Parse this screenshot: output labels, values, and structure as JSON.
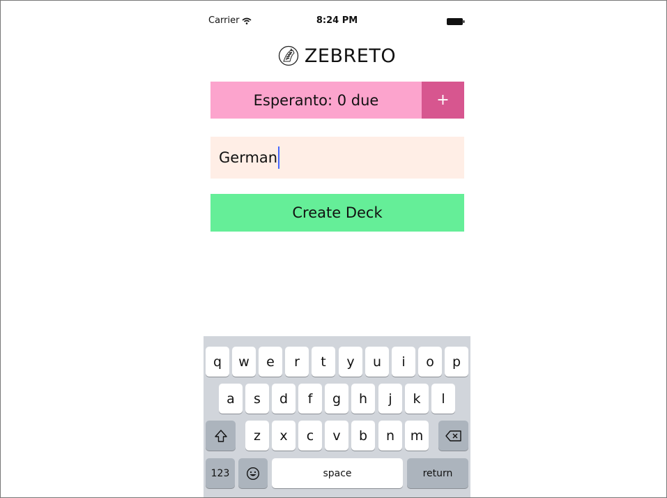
{
  "status_bar": {
    "carrier": "Carrier",
    "time": "8:24 PM"
  },
  "brand": {
    "name": "ZEBRETO"
  },
  "deck": {
    "label": "Esperanto: 0 due",
    "add_label": "+"
  },
  "new_deck_input": {
    "value": "German"
  },
  "create_button": {
    "label": "Create Deck"
  },
  "keyboard": {
    "row1": [
      "q",
      "w",
      "e",
      "r",
      "t",
      "y",
      "u",
      "i",
      "o",
      "p"
    ],
    "row2": [
      "a",
      "s",
      "d",
      "f",
      "g",
      "h",
      "j",
      "k",
      "l"
    ],
    "row3": [
      "z",
      "x",
      "c",
      "v",
      "b",
      "n",
      "m"
    ],
    "numbers_label": "123",
    "space_label": "space",
    "return_label": "return"
  },
  "colors": {
    "deck_bg": "#fca4cd",
    "add_bg": "#d7568f",
    "input_bg": "#ffeee6",
    "create_bg": "#65ee98",
    "keyboard_bg": "#d1d5db"
  }
}
